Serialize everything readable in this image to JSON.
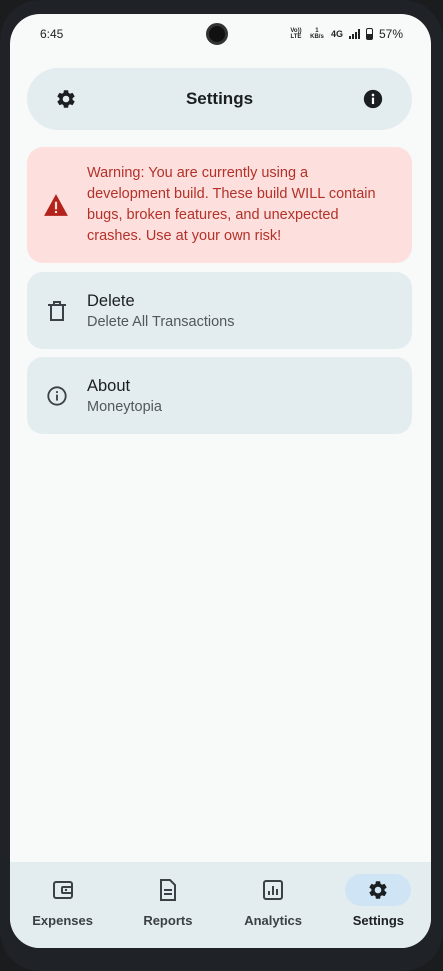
{
  "status_bar": {
    "time": "6:45",
    "volte": "Vo)) LTE",
    "speed_value": "1",
    "speed_unit": "KB/s",
    "network": "4G",
    "battery": "57%"
  },
  "top_bar": {
    "title": "Settings",
    "left_icon": "gear-icon",
    "right_icon": "info-icon"
  },
  "warning": {
    "text": "Warning: You are currently using a development build. These build WILL contain bugs, broken features, and unexpected crashes. Use at your own risk!",
    "color": "#b3312a",
    "background": "#fde0dd"
  },
  "settings": [
    {
      "title": "Delete",
      "subtitle": "Delete All Transactions",
      "icon": "trash-icon"
    },
    {
      "title": "About",
      "subtitle": "Moneytopia",
      "icon": "info-outline-icon"
    }
  ],
  "bottom_nav": {
    "items": [
      {
        "label": "Expenses",
        "icon": "wallet-icon"
      },
      {
        "label": "Reports",
        "icon": "document-icon"
      },
      {
        "label": "Analytics",
        "icon": "chart-icon"
      },
      {
        "label": "Settings",
        "icon": "gear-icon",
        "active": true
      }
    ]
  }
}
